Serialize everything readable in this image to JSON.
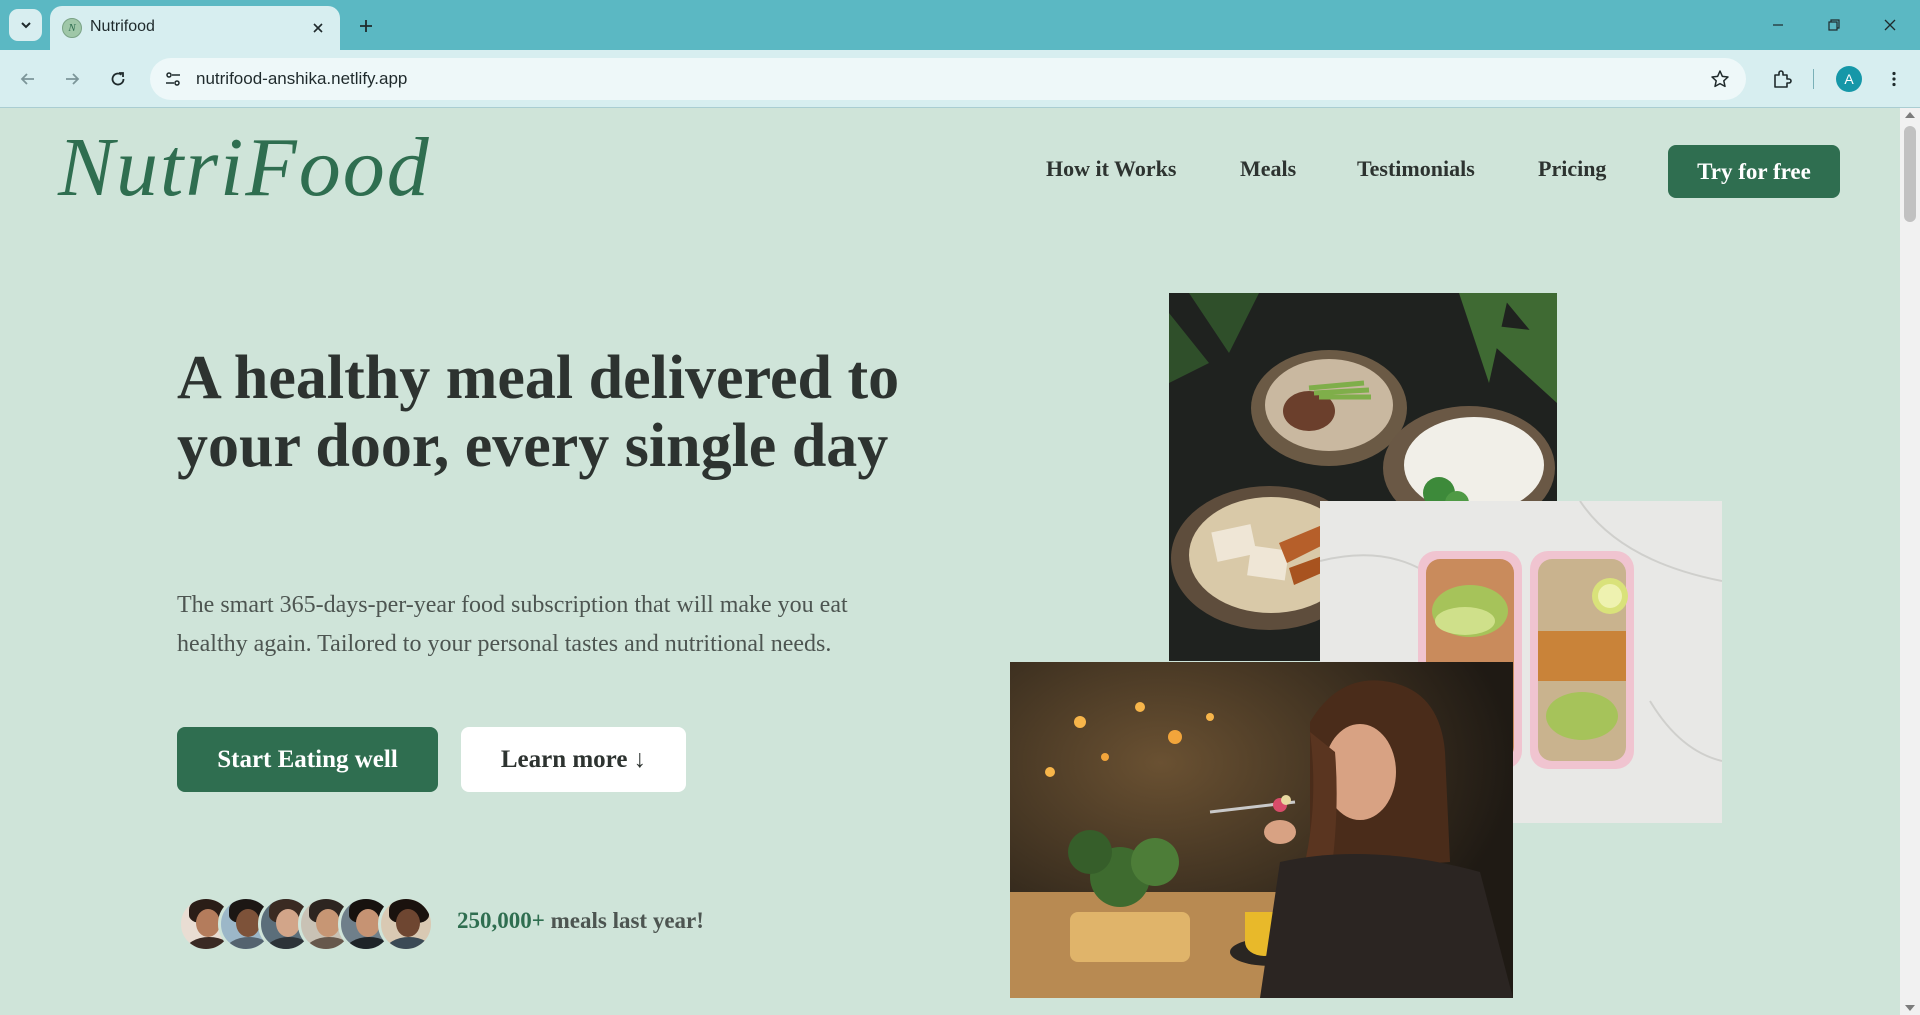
{
  "browser": {
    "tab_title": "Nutrifood",
    "favicon_letter": "N",
    "url": "nutrifood-anshika.netlify.app",
    "profile_initial": "A",
    "colors": {
      "tabstrip": "#5bb8c3",
      "toolbar": "#d7eef0"
    }
  },
  "header": {
    "logo": "NutriFood",
    "nav": [
      "How it Works",
      "Meals",
      "Testimonials",
      "Pricing"
    ],
    "cta": "Try for free"
  },
  "hero": {
    "title": "A healthy meal delivered to your door, every single day",
    "description": "The smart 365-days-per-year food subscription that will make you eat healthy again. Tailored to your personal tastes and nutritional needs.",
    "primary_button": "Start Eating well",
    "secondary_button": "Learn more ↓",
    "delivered_count": "250,000+",
    "delivered_text": "meals last year!"
  },
  "images": [
    "bowls-photo",
    "meal-prep-containers-photo",
    "woman-eating-photo"
  ],
  "colors": {
    "brand": "#2f6e50",
    "background": "#cfe4d9",
    "text": "#2d3330"
  }
}
